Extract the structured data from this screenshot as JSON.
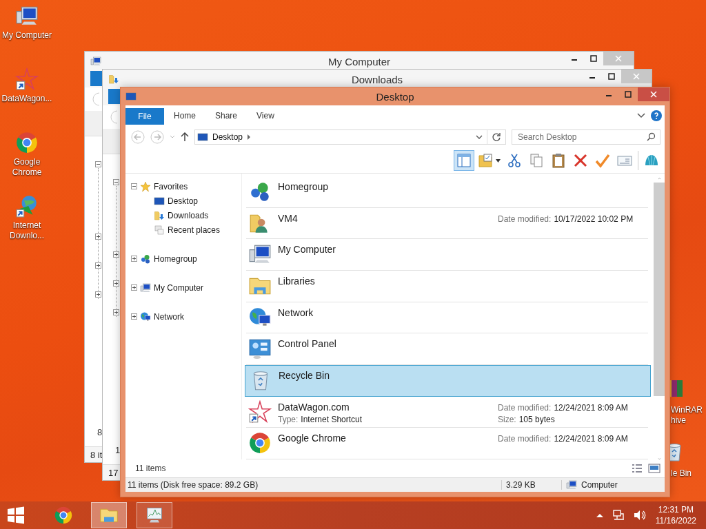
{
  "desktop_icons": [
    {
      "label": "My Computer",
      "kind": "computer"
    },
    {
      "label": "DataWagon...",
      "kind": "datawagon"
    },
    {
      "label": "Google Chrome",
      "kind": "chrome"
    },
    {
      "label": "Internet Downlo...",
      "kind": "idm"
    }
  ],
  "desktop_icons_partly_hidden": [
    {
      "label": "WinRAR hive",
      "kind": "winrar"
    },
    {
      "label": "le Bin",
      "kind": "recycle"
    }
  ],
  "back_windows": [
    {
      "title": "My Computer",
      "kind": "computer",
      "tree_toggles": [
        {
          "expanded": true
        },
        {
          "expanded": false
        },
        {
          "expanded": false
        },
        {
          "expanded": false
        }
      ],
      "count": "8",
      "status": "8 it"
    },
    {
      "title": "Downloads",
      "kind": "downloads",
      "tree_toggles": [
        {
          "expanded": true
        },
        {
          "expanded": false
        },
        {
          "expanded": false
        },
        {
          "expanded": false
        }
      ],
      "count": "1",
      "status": "17"
    }
  ],
  "window": {
    "title": "Desktop",
    "ribbon_tabs": [
      {
        "label": "File",
        "kind": "file"
      },
      {
        "label": "Home",
        "kind": "tab"
      },
      {
        "label": "Share",
        "kind": "tab"
      },
      {
        "label": "View",
        "kind": "tab"
      }
    ],
    "address": "Desktop",
    "search": {
      "placeholder": "Search Desktop"
    },
    "preview_pane": {
      "on": true
    },
    "toolbar": [
      {
        "kind": "properties"
      },
      {
        "kind": "cut"
      },
      {
        "kind": "copy"
      },
      {
        "kind": "paste"
      },
      {
        "kind": "delete"
      },
      {
        "kind": "check"
      },
      {
        "kind": "rename"
      },
      {
        "kind": "shell"
      }
    ],
    "nav": [
      {
        "label": "Favorites",
        "kind": "star",
        "expanded": true,
        "children": [
          {
            "label": "Desktop",
            "kind": "desktop"
          },
          {
            "label": "Downloads",
            "kind": "downloads"
          },
          {
            "label": "Recent places",
            "kind": "recent"
          }
        ]
      },
      {
        "label": "Homegroup",
        "kind": "homegroup",
        "expanded": false
      },
      {
        "label": "My Computer",
        "kind": "computer",
        "expanded": false
      },
      {
        "label": "Network",
        "kind": "network",
        "expanded": false
      }
    ],
    "items": [
      {
        "name": "Homegroup",
        "kind": "homegroup",
        "selected": false
      },
      {
        "name": "VM4",
        "kind": "user-folder",
        "selected": false,
        "details": [
          {
            "label": "Date modified:",
            "value": "10/17/2022 10:02 PM"
          }
        ]
      },
      {
        "name": "My Computer",
        "kind": "computer",
        "selected": false
      },
      {
        "name": "Libraries",
        "kind": "libraries",
        "selected": false
      },
      {
        "name": "Network",
        "kind": "network",
        "selected": false
      },
      {
        "name": "Control Panel",
        "kind": "control-panel",
        "selected": false
      },
      {
        "name": "Recycle Bin",
        "kind": "recycle",
        "selected": true
      },
      {
        "name": "DataWagon.com",
        "kind": "datawagon",
        "selected": false,
        "info": [
          {
            "label": "Type:",
            "value": "Internet Shortcut"
          }
        ],
        "details": [
          {
            "label": "Date modified:",
            "value": "12/24/2021 8:09 AM"
          },
          {
            "label": "Size:",
            "value": "105 bytes"
          }
        ]
      },
      {
        "name": "Google Chrome",
        "kind": "chrome",
        "selected": false,
        "details": [
          {
            "label": "Date modified:",
            "value": "12/24/2021 8:09 AM"
          }
        ]
      }
    ],
    "item_count": "11 items",
    "status_bar": [
      "11 items (Disk free space: 89.2 GB)",
      "3.29 KB",
      "Computer"
    ]
  },
  "taskbar": {
    "apps": [
      {
        "kind": "chrome",
        "running": false,
        "selected": false
      },
      {
        "kind": "explorer",
        "running": true,
        "selected": true
      },
      {
        "kind": "monitor",
        "running": true,
        "selected": false
      }
    ],
    "time": "12:31 PM",
    "date": "11/16/2022"
  }
}
